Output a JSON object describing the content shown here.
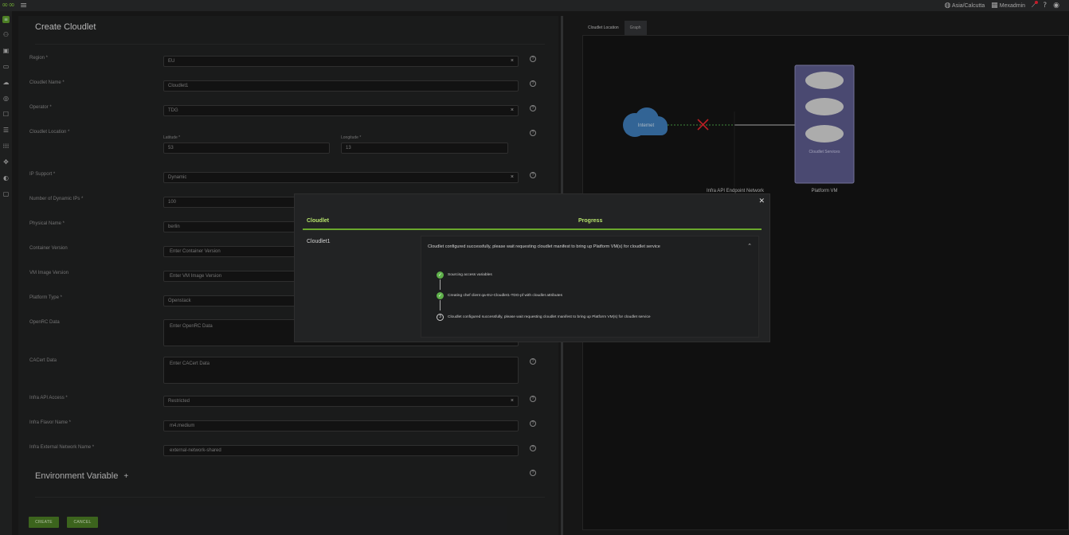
{
  "topbar": {
    "timezone": "Asia/Calcutta",
    "org": "Mexadmin"
  },
  "form": {
    "title": "Create Cloudlet",
    "fields": {
      "region": {
        "label": "Region",
        "value": "EU"
      },
      "cloudlet_name": {
        "label": "Cloudlet Name",
        "value": "Cloudlet1"
      },
      "operator": {
        "label": "Operator",
        "value": "TDG"
      },
      "cloudlet_location": {
        "label": "Cloudlet Location",
        "lat_label": "Latitude",
        "lat_value": "53",
        "lon_label": "Longitude",
        "lon_value": "13"
      },
      "ip_support": {
        "label": "IP Support",
        "value": "Dynamic"
      },
      "num_dynamic_ips": {
        "label": "Number of Dynamic IPs",
        "value": "100"
      },
      "physical_name": {
        "label": "Physical Name",
        "value": "berlin"
      },
      "container_version": {
        "label": "Container Version",
        "placeholder": "Enter Container Version"
      },
      "vm_image_version": {
        "label": "VM Image Version",
        "placeholder": "Enter VM Image Version"
      },
      "platform_type": {
        "label": "Platform Type",
        "value": "Openstack"
      },
      "openrc_data": {
        "label": "OpenRC Data",
        "placeholder": "Enter OpenRC Data"
      },
      "cacert_data": {
        "label": "CACert Data",
        "placeholder": "Enter CACert Data"
      },
      "infra_api_access": {
        "label": "Infra API Access",
        "value": "Restricted"
      },
      "infra_flavor_name": {
        "label": "Infra Flavor Name",
        "value": "m4.medium"
      },
      "infra_ext_network": {
        "label": "Infra External Network Name",
        "value": "external-network-shared"
      }
    },
    "env_title": "Environment Variable",
    "env_add": "+",
    "create_label": "CREATE",
    "cancel_label": "CANCEL"
  },
  "right": {
    "tabs": [
      "Cloudlet Location",
      "Graph"
    ],
    "graph": {
      "internet_label": "Internet",
      "services_label": "Cloudlet Services",
      "network_label": "Infra API Endpoint Network",
      "vm_label": "Platform VM"
    }
  },
  "modal": {
    "col_cloudlet": "Cloudlet",
    "col_progress": "Progress",
    "cloudlet_name": "Cloudlet1",
    "progress_header": "Cloudlet configured successfully, please wait requesting cloudlet manifest to bring up Platform VM(s) for cloudlet service",
    "steps": [
      {
        "text": "Sourcing access variables",
        "status": "done"
      },
      {
        "text": "Creating chef client qa-EU-Cloudlet1-TDG-pf with cloudlet attributes",
        "status": "done"
      },
      {
        "text": "Cloudlet configured successfully, please wait requesting cloudlet manifest to bring up Platform VM(s) for cloudlet service",
        "status": "in-progress"
      }
    ]
  },
  "colors": {
    "accent": "#6aa82c",
    "accent_text": "#b6e36b",
    "error": "#e0282d",
    "internet_cloud": "#3e7bb6",
    "vm_box": "#5b5a8a"
  }
}
